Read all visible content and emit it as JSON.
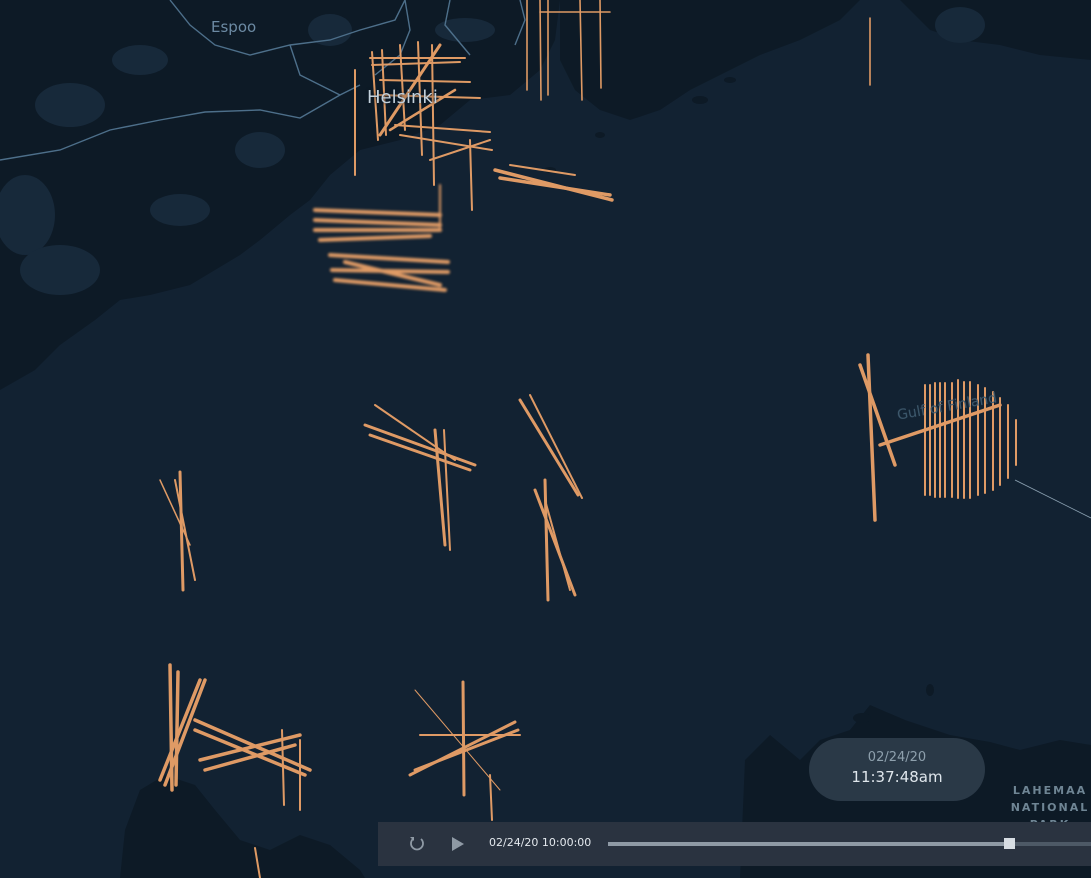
{
  "map": {
    "labels": {
      "espoo": "Espoo",
      "helsinki": "Helsinki",
      "gulf": "Gulf of Finland",
      "lahemaa": "LAHEMAA NATIONAL PARK"
    },
    "colors": {
      "water": "#122232",
      "land": "#0d1a26",
      "land_detail": "#17293a",
      "road": "#4d6f8a",
      "trip": "#f2a66a"
    }
  },
  "time_display": {
    "date": "02/24/20",
    "time": "11:37:48am"
  },
  "playback": {
    "reset_icon": "reset-icon",
    "play_icon": "play-icon",
    "start_time": "02/24/20 10:00:00",
    "progress": 0.83
  }
}
